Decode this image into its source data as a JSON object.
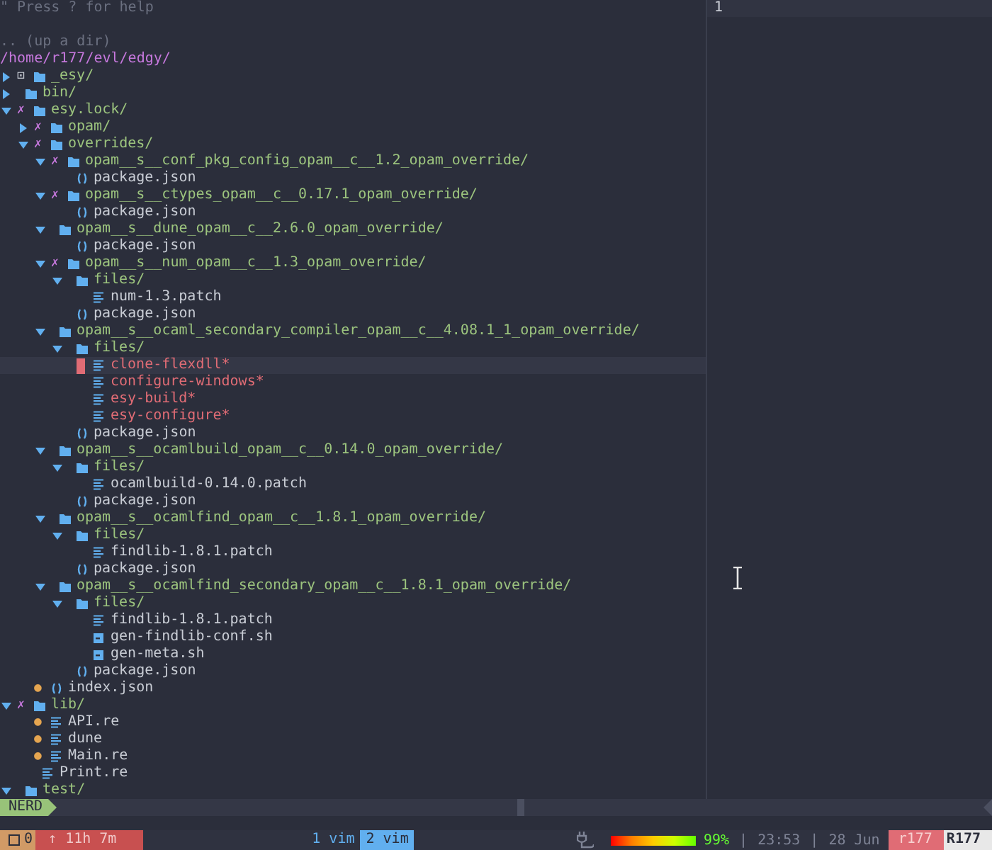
{
  "help": "\" Press ? for help",
  "up_dir": ".. (up a dir)",
  "path": "/home/r177/evl/edgy/",
  "tree": [
    {
      "name": "_esy/",
      "kind": "dir",
      "git": {
        "mark": "⊡",
        "color": "#c8ccd4"
      },
      "expanded": false,
      "selected": false
    },
    {
      "name": "bin/",
      "kind": "dir",
      "expanded": false,
      "selected": false
    },
    {
      "name": "esy.lock/",
      "kind": "dir",
      "git": {
        "mark": "✗",
        "color": "#c678dd"
      },
      "expanded": true,
      "selected": false,
      "children": [
        {
          "name": "opam/",
          "kind": "dir",
          "git": {
            "mark": "✗",
            "color": "#c678dd"
          },
          "expanded": false,
          "selected": false
        },
        {
          "name": "overrides/",
          "kind": "dir",
          "git": {
            "mark": "✗",
            "color": "#c678dd"
          },
          "expanded": true,
          "selected": false,
          "children": [
            {
              "name": "opam__s__conf_pkg_config_opam__c__1.2_opam_override/",
              "kind": "dir",
              "git": {
                "mark": "✗",
                "color": "#c678dd"
              },
              "expanded": true,
              "selected": false,
              "children": [
                {
                  "name": "package.json",
                  "kind": "json",
                  "selected": false
                }
              ]
            },
            {
              "name": "opam__s__ctypes_opam__c__0.17.1_opam_override/",
              "kind": "dir",
              "git": {
                "mark": "✗",
                "color": "#c678dd"
              },
              "expanded": true,
              "selected": false,
              "children": [
                {
                  "name": "package.json",
                  "kind": "json",
                  "selected": false
                }
              ]
            },
            {
              "name": "opam__s__dune_opam__c__2.6.0_opam_override/",
              "kind": "dir",
              "expanded": true,
              "selected": false,
              "children": [
                {
                  "name": "package.json",
                  "kind": "json",
                  "selected": false
                }
              ]
            },
            {
              "name": "opam__s__num_opam__c__1.3_opam_override/",
              "kind": "dir",
              "git": {
                "mark": "✗",
                "color": "#c678dd"
              },
              "expanded": true,
              "selected": false,
              "children": [
                {
                  "name": "files/",
                  "kind": "dir",
                  "expanded": true,
                  "selected": false,
                  "children": [
                    {
                      "name": "num-1.3.patch",
                      "kind": "text",
                      "selected": false
                    }
                  ]
                },
                {
                  "name": "package.json",
                  "kind": "json",
                  "selected": false
                }
              ]
            },
            {
              "name": "opam__s__ocaml_secondary_compiler_opam__c__4.08.1_1_opam_override/",
              "kind": "dir",
              "expanded": true,
              "selected": false,
              "children": [
                {
                  "name": "files/",
                  "kind": "dir",
                  "expanded": true,
                  "selected": false,
                  "children": [
                    {
                      "name": "clone-flexdll*",
                      "kind": "executable",
                      "selected": true
                    },
                    {
                      "name": "configure-windows*",
                      "kind": "executable",
                      "selected": false
                    },
                    {
                      "name": "esy-build*",
                      "kind": "executable",
                      "selected": false
                    },
                    {
                      "name": "esy-configure*",
                      "kind": "executable",
                      "selected": false
                    }
                  ]
                },
                {
                  "name": "package.json",
                  "kind": "json",
                  "selected": false
                }
              ]
            },
            {
              "name": "opam__s__ocamlbuild_opam__c__0.14.0_opam_override/",
              "kind": "dir",
              "expanded": true,
              "selected": false,
              "children": [
                {
                  "name": "files/",
                  "kind": "dir",
                  "expanded": true,
                  "selected": false,
                  "children": [
                    {
                      "name": "ocamlbuild-0.14.0.patch",
                      "kind": "text",
                      "selected": false
                    }
                  ]
                },
                {
                  "name": "package.json",
                  "kind": "json",
                  "selected": false
                }
              ]
            },
            {
              "name": "opam__s__ocamlfind_opam__c__1.8.1_opam_override/",
              "kind": "dir",
              "expanded": true,
              "selected": false,
              "children": [
                {
                  "name": "files/",
                  "kind": "dir",
                  "expanded": true,
                  "selected": false,
                  "children": [
                    {
                      "name": "findlib-1.8.1.patch",
                      "kind": "text",
                      "selected": false
                    }
                  ]
                },
                {
                  "name": "package.json",
                  "kind": "json",
                  "selected": false
                }
              ]
            },
            {
              "name": "opam__s__ocamlfind_secondary_opam__c__1.8.1_opam_override/",
              "kind": "dir",
              "expanded": true,
              "selected": false,
              "children": [
                {
                  "name": "files/",
                  "kind": "dir",
                  "expanded": true,
                  "selected": false,
                  "children": [
                    {
                      "name": "findlib-1.8.1.patch",
                      "kind": "text",
                      "selected": false
                    },
                    {
                      "name": "gen-findlib-conf.sh",
                      "kind": "script",
                      "selected": false
                    },
                    {
                      "name": "gen-meta.sh",
                      "kind": "script",
                      "selected": false
                    }
                  ]
                },
                {
                  "name": "package.json",
                  "kind": "json",
                  "selected": false
                }
              ]
            }
          ]
        },
        {
          "name": "index.json",
          "kind": "json",
          "git": {
            "mark": "●",
            "color": "#e5a550"
          },
          "selected": false
        }
      ]
    },
    {
      "name": "lib/",
      "kind": "dir",
      "git": {
        "mark": "✗",
        "color": "#c678dd"
      },
      "expanded": true,
      "selected": false,
      "children": [
        {
          "name": "API.re",
          "kind": "text",
          "git": {
            "mark": "●",
            "color": "#e5a550"
          },
          "selected": false
        },
        {
          "name": "dune",
          "kind": "text",
          "git": {
            "mark": "●",
            "color": "#e5a550"
          },
          "selected": false
        },
        {
          "name": "Main.re",
          "kind": "text",
          "git": {
            "mark": "●",
            "color": "#e5a550"
          },
          "selected": false
        },
        {
          "name": "Print.re",
          "kind": "text",
          "selected": false
        }
      ]
    },
    {
      "name": "test/",
      "kind": "dir",
      "expanded": true,
      "selected": false
    }
  ],
  "statusline": {
    "mode": "NERD"
  },
  "right_pane": {
    "line_number": "1"
  },
  "tmux": {
    "session": "0",
    "uptime": "↑ 11h 7m",
    "windows": [
      {
        "label": "1 vim",
        "selected": false
      },
      {
        "label": "2 vim",
        "selected": true
      }
    ],
    "battery": {
      "level": 0.99,
      "reading": "99%"
    },
    "separators": [
      "|",
      "|"
    ],
    "time": "23:53",
    "date": "28 Jun",
    "user": "r177",
    "host": "R177"
  }
}
